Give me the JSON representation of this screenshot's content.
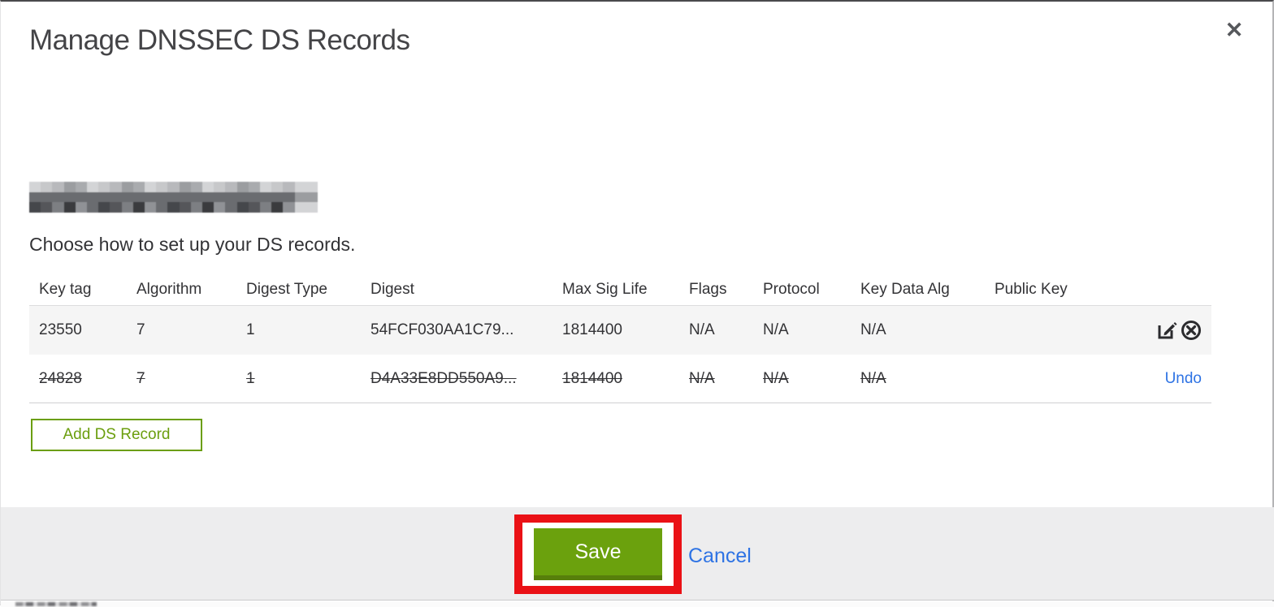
{
  "modal": {
    "title": "Manage DNSSEC DS Records",
    "close_icon": "✕"
  },
  "intro": {
    "instruction": "Choose how to set up your DS records."
  },
  "table": {
    "columns": [
      "Key tag",
      "Algorithm",
      "Digest Type",
      "Digest",
      "Max Sig Life",
      "Flags",
      "Protocol",
      "Key Data Alg",
      "Public Key"
    ],
    "rows": [
      {
        "key_tag": "23550",
        "algorithm": "7",
        "digest_type": "1",
        "digest": "54FCF030AA1C79...",
        "max_sig_life": "1814400",
        "flags": "N/A",
        "protocol": "N/A",
        "key_data_alg": "N/A",
        "public_key": "",
        "state": "active"
      },
      {
        "key_tag": "24828",
        "algorithm": "7",
        "digest_type": "1",
        "digest": "D4A33E8DD550A9...",
        "max_sig_life": "1814400",
        "flags": "N/A",
        "protocol": "N/A",
        "key_data_alg": "N/A",
        "public_key": "",
        "state": "deleted",
        "undo_label": "Undo"
      }
    ]
  },
  "buttons": {
    "add_record": "Add DS Record",
    "save": "Save",
    "cancel": "Cancel"
  },
  "colors": {
    "accent_green": "#6ba10d",
    "outline_green": "#6b9e0e",
    "link_blue": "#2e73e4",
    "annotation_red": "#ea1116",
    "row_highlight": "#f5f5f5",
    "footer_gray": "#ededee"
  }
}
